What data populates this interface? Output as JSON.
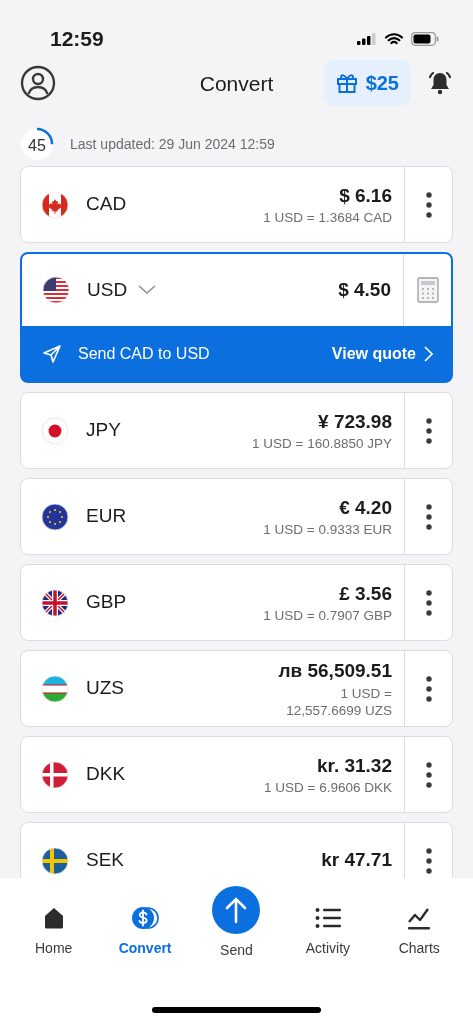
{
  "status_bar": {
    "time": "12:59"
  },
  "header": {
    "title": "Convert",
    "reward": "$25"
  },
  "refresh": {
    "countdown": "45",
    "text": "Last updated: 29 Jun 2024 12:59"
  },
  "currencies": [
    {
      "code": "CAD",
      "amount": "$ 6.16",
      "rate": "1 USD = 1.3684 CAD",
      "selected": false
    },
    {
      "code": "USD",
      "amount": "$ 4.50",
      "selected": true
    },
    {
      "code": "JPY",
      "amount": "¥ 723.98",
      "rate": "1 USD = 160.8850 JPY",
      "selected": false
    },
    {
      "code": "EUR",
      "amount": "€ 4.20",
      "rate": "1 USD = 0.9333 EUR",
      "selected": false
    },
    {
      "code": "GBP",
      "amount": "£ 3.56",
      "rate": "1 USD = 0.7907 GBP",
      "selected": false
    },
    {
      "code": "UZS",
      "amount": "лв 56,509.51",
      "rate": "1 USD =\n12,557.6699 UZS",
      "selected": false
    },
    {
      "code": "DKK",
      "amount": "kr. 31.32",
      "rate": "1 USD = 6.9606 DKK",
      "selected": false
    },
    {
      "code": "SEK",
      "amount": "kr 47.71",
      "selected": false
    }
  ],
  "send_bar": {
    "label": "Send CAD to USD",
    "action": "View quote"
  },
  "tabs": [
    {
      "label": "Home",
      "kind": "tab",
      "selected": false
    },
    {
      "label": "Convert",
      "kind": "tab",
      "selected": true
    },
    {
      "label": "Send",
      "kind": "action",
      "selected": false
    },
    {
      "label": "Activity",
      "kind": "tab",
      "selected": false
    },
    {
      "label": "Charts",
      "kind": "tab",
      "selected": false
    }
  ]
}
